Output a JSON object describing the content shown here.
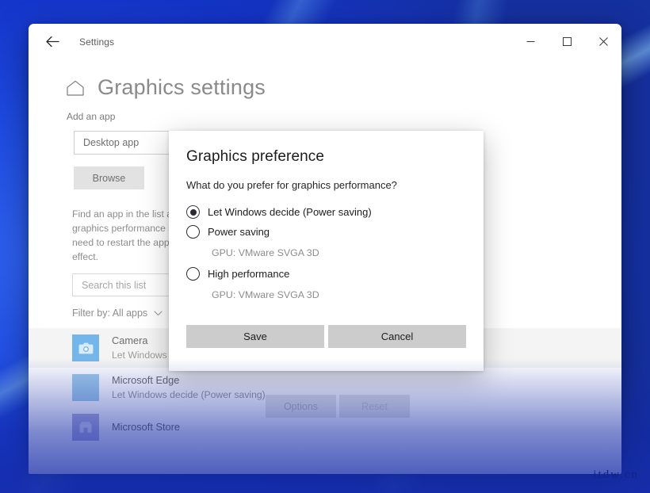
{
  "window": {
    "back_icon": "back-arrow-icon",
    "app_title": "Settings",
    "minimize_label": "–",
    "maximize_label": "☐",
    "close_label": "✕"
  },
  "page": {
    "home_icon": "home-icon",
    "title": "Graphics settings",
    "add_app_label": "Add an app",
    "app_type_value": "Desktop app",
    "browse_label": "Browse",
    "help_text": "Find an app in the list and select Options to set graphics performance settings for it. You might need to restart the app for your settings to take effect.",
    "search_placeholder": "Search this list",
    "filter_label": "Filter by: All apps",
    "filter_chevron": "chevron-down-icon"
  },
  "apps": [
    {
      "name": "Camera",
      "preference": "Let Windows decide (Power saving)",
      "icon": "camera-icon"
    },
    {
      "name": "Microsoft Edge",
      "preference": "Let Windows decide (Power saving)",
      "icon": "edge-icon"
    },
    {
      "name": "Microsoft Store",
      "preference": "",
      "icon": "store-icon"
    }
  ],
  "row_actions": {
    "options_label": "Options",
    "reset_label": "Reset"
  },
  "dialog": {
    "title": "Graphics preference",
    "question": "What do you prefer for graphics performance?",
    "options": [
      {
        "label": "Let Windows decide (Power saving)",
        "selected": true,
        "gpu": ""
      },
      {
        "label": "Power saving",
        "selected": false,
        "gpu": "GPU: VMware SVGA 3D"
      },
      {
        "label": "High performance",
        "selected": false,
        "gpu": "GPU: VMware SVGA 3D"
      }
    ],
    "save_label": "Save",
    "cancel_label": "Cancel"
  },
  "watermark": "itdw.cn",
  "colors": {
    "accent_blue": "#1d49e0",
    "button_grey": "#cccccc",
    "text_primary": "#1d1d1d",
    "text_muted": "#8d8d8d"
  }
}
